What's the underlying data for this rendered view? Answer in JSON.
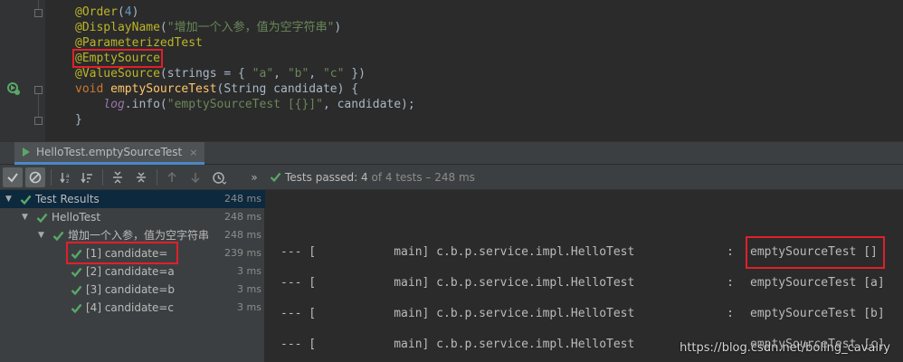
{
  "editor": {
    "lines": [
      {
        "parts": [
          {
            "t": "@Order",
            "c": "ann"
          },
          {
            "t": "(",
            "c": ""
          },
          {
            "t": "4",
            "c": "num"
          },
          {
            "t": ")",
            "c": ""
          }
        ]
      },
      {
        "parts": [
          {
            "t": "@DisplayName",
            "c": "ann"
          },
          {
            "t": "(",
            "c": ""
          },
          {
            "t": "\"增加一个入参，值为空字符串\"",
            "c": "str"
          },
          {
            "t": ")",
            "c": ""
          }
        ]
      },
      {
        "parts": [
          {
            "t": "@ParameterizedTest",
            "c": "ann"
          }
        ]
      },
      {
        "parts": [
          {
            "t": "@EmptySource",
            "c": "ann",
            "highlight": true
          }
        ]
      },
      {
        "parts": [
          {
            "t": "@ValueSource",
            "c": "ann"
          },
          {
            "t": "(strings = { ",
            "c": ""
          },
          {
            "t": "\"a\"",
            "c": "str"
          },
          {
            "t": ", ",
            "c": ""
          },
          {
            "t": "\"b\"",
            "c": "str"
          },
          {
            "t": ", ",
            "c": ""
          },
          {
            "t": "\"c\"",
            "c": "str"
          },
          {
            "t": " })",
            "c": ""
          }
        ]
      },
      {
        "parts": [
          {
            "t": "void ",
            "c": "kw"
          },
          {
            "t": "emptySourceTest",
            "c": "fn"
          },
          {
            "t": "(String candidate) {",
            "c": ""
          }
        ]
      },
      {
        "parts": [
          {
            "t": "    ",
            "c": ""
          },
          {
            "t": "log",
            "c": "fld"
          },
          {
            "t": ".info(",
            "c": ""
          },
          {
            "t": "\"emptySourceTest [{}]\"",
            "c": "str"
          },
          {
            "t": ", candidate);",
            "c": ""
          }
        ]
      },
      {
        "parts": [
          {
            "t": "}",
            "c": ""
          }
        ]
      }
    ]
  },
  "run_tab": {
    "label": "HelloTest.emptySourceTest",
    "close": "×"
  },
  "toolbar": {
    "status_passed": "Tests passed: ",
    "status_count": "4",
    "status_rest": " of 4 tests – 248 ms"
  },
  "tree": {
    "rows": [
      {
        "label": "Test Results",
        "time": "248 ms",
        "level": 0,
        "expanded": true,
        "selected": true
      },
      {
        "label": "HelloTest",
        "time": "248 ms",
        "level": 1,
        "expanded": true
      },
      {
        "label": "增加一个入参，值为空字符串",
        "time": "248 ms",
        "level": 2,
        "expanded": true
      },
      {
        "label": "[1] candidate=",
        "time": "239 ms",
        "level": 3,
        "highlight": true
      },
      {
        "label": "[2] candidate=a",
        "time": "3 ms",
        "level": 3
      },
      {
        "label": "[3] candidate=b",
        "time": "3 ms",
        "level": 3
      },
      {
        "label": "[4] candidate=c",
        "time": "3 ms",
        "level": 3
      }
    ]
  },
  "console": {
    "lines": [
      {
        "prefix": "--- [           main] c.b.p.service.impl.HelloTest             :",
        "msg": "emptySourceTest []"
      },
      {
        "prefix": "--- [           main] c.b.p.service.impl.HelloTest             :",
        "msg": "emptySourceTest [a]"
      },
      {
        "prefix": "--- [           main] c.b.p.service.impl.HelloTest             :",
        "msg": "emptySourceTest [b]"
      },
      {
        "prefix": "--- [           main] c.b.p.service.impl.HelloTest    ",
        "msg": "emptySourceTest [c]"
      }
    ]
  },
  "watermark": "https://blog.csdn.net/boling_cavalry",
  "colors": {
    "pass_green": "#59a869",
    "highlight_red": "#e0202a",
    "selection": "#0d293e"
  }
}
